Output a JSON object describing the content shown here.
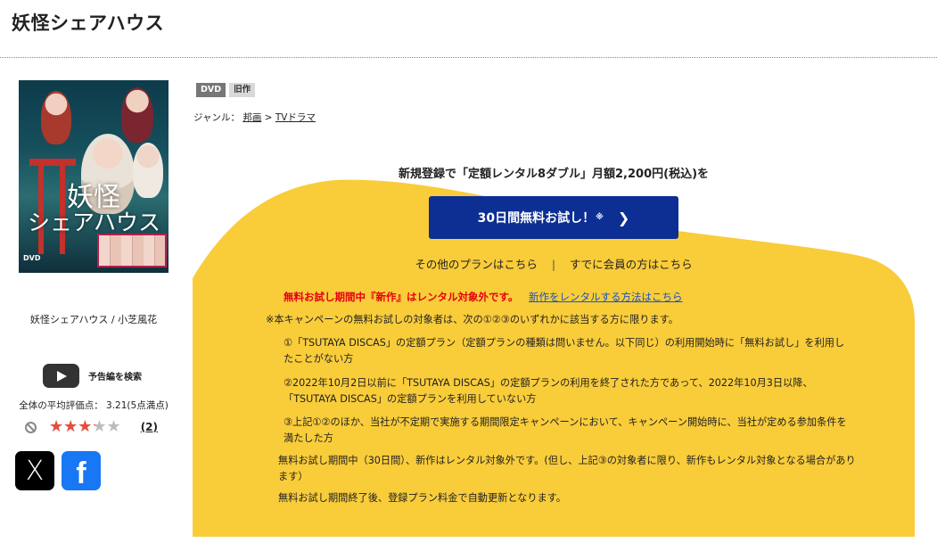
{
  "page": {
    "title": "妖怪シェアハウス"
  },
  "cover": {
    "title_line1": "妖怪",
    "title_line2": "シェアハウス",
    "dvd_mark": "DVD",
    "caption": "妖怪シェアハウス / 小芝風花"
  },
  "trailer": {
    "label": "予告編を検索"
  },
  "rating": {
    "average_text": "全体の平均評価点： 3.21(5点満点)",
    "average_value": 3.21,
    "max": 5,
    "stars_text": "★★★★★",
    "review_count": "(2)"
  },
  "social": {
    "x_glyph": "X",
    "fb_glyph": "f"
  },
  "badges": {
    "format": "DVD",
    "status": "旧作"
  },
  "genre": {
    "label": "ジャンル：",
    "cat1": "邦画",
    "separator": ">",
    "cat2": "TVドラマ"
  },
  "promo": {
    "headline": "新規登録で「定額レンタル8ダブル」月額2,200円(税込)を",
    "cta_label": "30日間無料お試し！",
    "cta_mark": "※",
    "cta_chevron": "❯",
    "other_plans": "その他のプランはこちら",
    "link_separator": "|",
    "member_login": "すでに会員の方はこちら",
    "red_notice": "無料お試し期間中『新作』はレンタル対象外です。",
    "red_link": "新作をレンタルする方法はこちら",
    "note_intro": "※本キャンペーンの無料お試しの対象者は、次の①②③のいずれかに該当する方に限ります。",
    "note_1": "①「TSUTAYA DISCAS」の定額プラン（定額プランの種類は問いません。以下同じ）の利用開始時に「無料お試し」を利用したことがない方",
    "note_2": "②2022年10月2日以前に「TSUTAYA DISCAS」の定額プランの利用を終了された方であって、2022年10月3日以降、「TSUTAYA DISCAS」の定額プランを利用していない方",
    "note_3": "③上記①②のほか、当社が不定期で実施する期間限定キャンペーンにおいて、キャンペーン開始時に、当社が定める参加条件を満たした方",
    "note_4": "無料お試し期間中（30日間）、新作はレンタル対象外です。(但し、上記③の対象者に限り、新作もレンタル対象となる場合があります）",
    "note_5": "無料お試し期間終了後、登録プラン料金で自動更新となります。"
  },
  "colors": {
    "promo_yellow": "#f9cc3a",
    "cta_blue": "#0d2f93",
    "notice_red": "#e60012",
    "link_blue": "#1a54c4",
    "star_red": "#e74c3c",
    "x_black": "#000000",
    "facebook_blue": "#1877f2"
  },
  "icons": {
    "trailer": "youtube-play-icon",
    "no_rating": "prohibited-icon",
    "x": "x-logo-icon",
    "facebook": "facebook-logo-icon"
  }
}
